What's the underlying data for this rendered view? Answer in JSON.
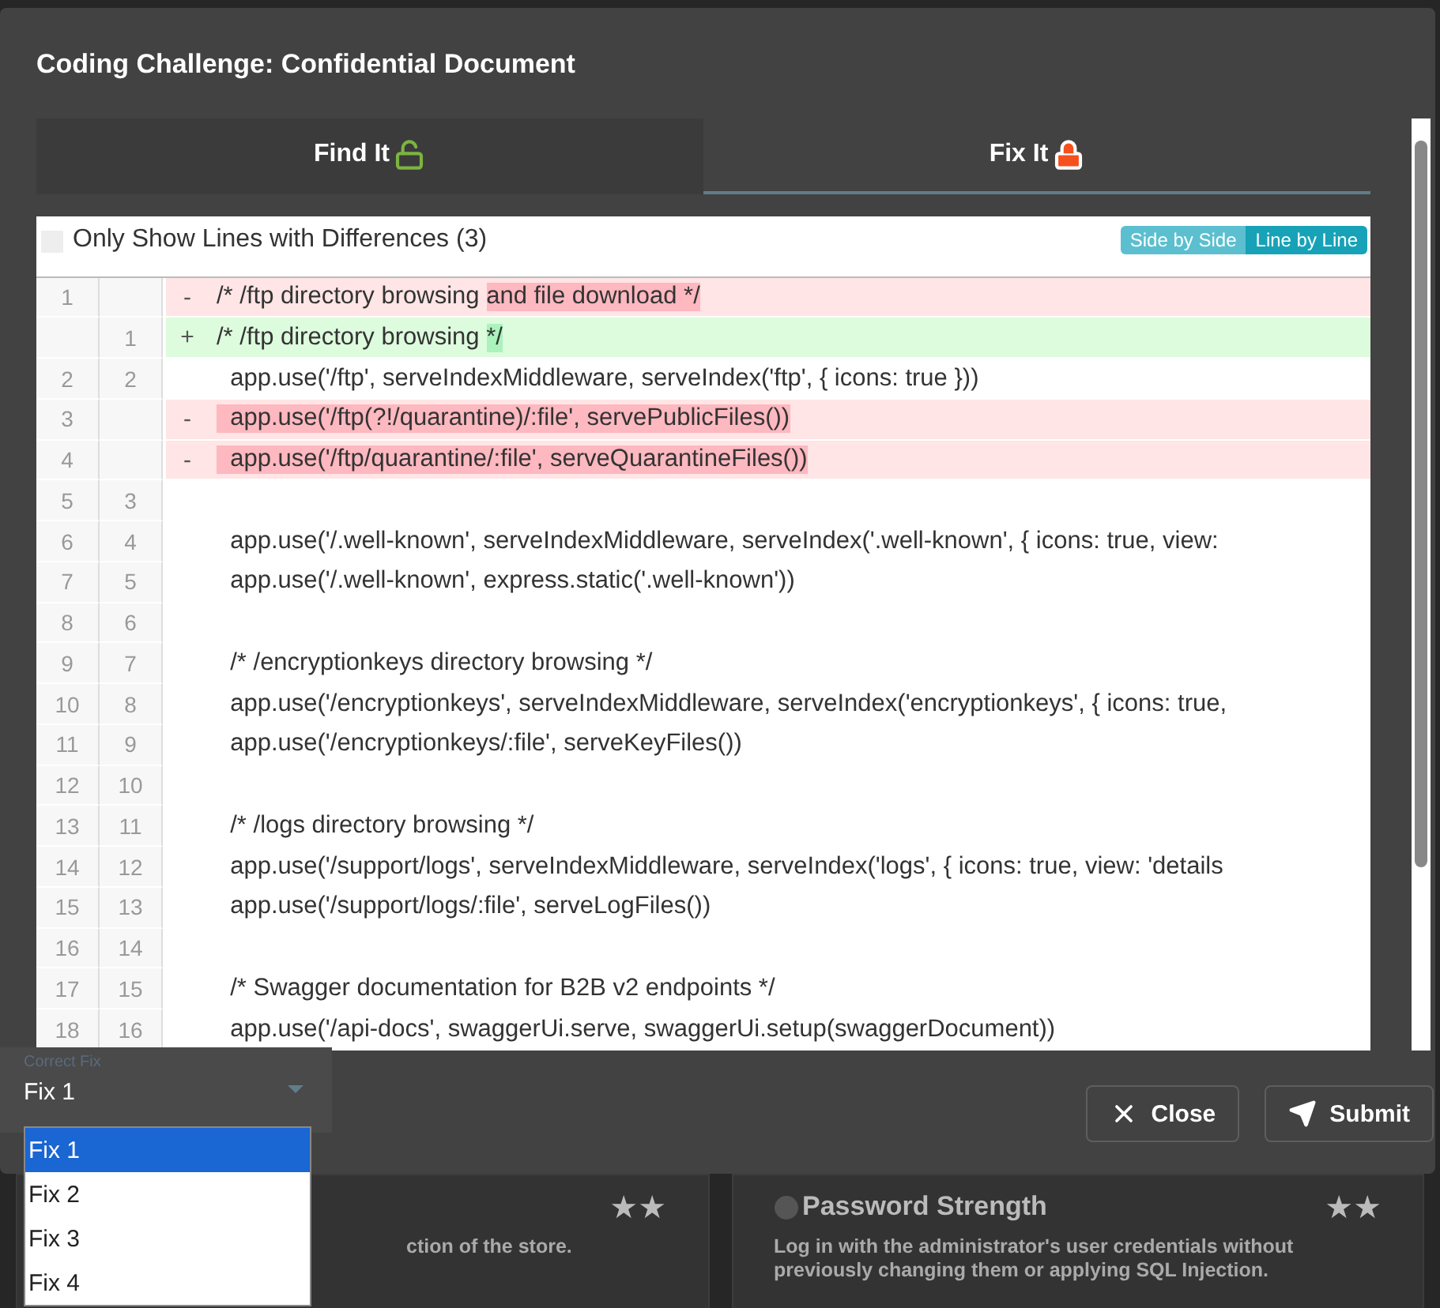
{
  "dialog": {
    "title": "Coding Challenge: Confidential Document",
    "tabs": [
      {
        "label": "Find It",
        "selected": false,
        "locked": false
      },
      {
        "label": "Fix It",
        "selected": true,
        "locked": true
      }
    ],
    "diff": {
      "filter": {
        "label": "Only Show Lines with Differences (3)",
        "checked": false
      },
      "views": [
        {
          "label": "Side by Side",
          "selected": false
        },
        {
          "label": "Line by Line",
          "selected": true
        }
      ],
      "lines": [
        {
          "old": "1",
          "kind": "del",
          "sign": "-",
          "parts": [
            {
              "text": "/* /ftp directory browsing ",
              "hl": false
            },
            {
              "text": "and file download */",
              "hl": true
            }
          ]
        },
        {
          "new": "1",
          "kind": "ins",
          "sign": "+",
          "parts": [
            {
              "text": "/* /ftp directory browsing ",
              "hl": false
            },
            {
              "text": "*/",
              "hl": true
            }
          ]
        },
        {
          "old": "2",
          "new": "2",
          "kind": "ctx",
          "parts": [
            {
              "text": "  app.use('/ftp', serveIndexMiddleware, serveIndex('ftp', { icons: true }))",
              "hl": false
            }
          ]
        },
        {
          "old": "3",
          "kind": "del",
          "sign": "-",
          "parts": [
            {
              "text": "  app.use('/ftp(?!/quarantine)/:file', servePublicFiles())",
              "hl": true
            }
          ]
        },
        {
          "old": "4",
          "kind": "del",
          "sign": "-",
          "parts": [
            {
              "text": "  app.use('/ftp/quarantine/:file', serveQuarantineFiles())",
              "hl": true
            }
          ]
        },
        {
          "old": "5",
          "new": "3",
          "kind": "ctx"
        },
        {
          "old": "6",
          "new": "4",
          "kind": "ctx",
          "parts": [
            {
              "text": "  app.use('/.well-known', serveIndexMiddleware, serveIndex('.well-known', { icons: true, view:",
              "hl": false
            }
          ]
        },
        {
          "old": "7",
          "new": "5",
          "kind": "ctx",
          "parts": [
            {
              "text": "  app.use('/.well-known', express.static('.well-known'))",
              "hl": false
            }
          ]
        },
        {
          "old": "8",
          "new": "6",
          "kind": "ctx"
        },
        {
          "old": "9",
          "new": "7",
          "kind": "ctx",
          "parts": [
            {
              "text": "  /* /encryptionkeys directory browsing */",
              "hl": false
            }
          ]
        },
        {
          "old": "10",
          "new": "8",
          "kind": "ctx",
          "parts": [
            {
              "text": "  app.use('/encryptionkeys', serveIndexMiddleware, serveIndex('encryptionkeys', { icons: true,",
              "hl": false
            }
          ]
        },
        {
          "old": "11",
          "new": "9",
          "kind": "ctx",
          "parts": [
            {
              "text": "  app.use('/encryptionkeys/:file', serveKeyFiles())",
              "hl": false
            }
          ]
        },
        {
          "old": "12",
          "new": "10",
          "kind": "ctx"
        },
        {
          "old": "13",
          "new": "11",
          "kind": "ctx",
          "parts": [
            {
              "text": "  /* /logs directory browsing */",
              "hl": false
            }
          ]
        },
        {
          "old": "14",
          "new": "12",
          "kind": "ctx",
          "parts": [
            {
              "text": "  app.use('/support/logs', serveIndexMiddleware, serveIndex('logs', { icons: true, view: 'details",
              "hl": false
            }
          ]
        },
        {
          "old": "15",
          "new": "13",
          "kind": "ctx",
          "parts": [
            {
              "text": "  app.use('/support/logs/:file', serveLogFiles())",
              "hl": false
            }
          ]
        },
        {
          "old": "16",
          "new": "14",
          "kind": "ctx"
        },
        {
          "old": "17",
          "new": "15",
          "kind": "ctx",
          "parts": [
            {
              "text": "  /* Swagger documentation for B2B v2 endpoints */",
              "hl": false
            }
          ]
        },
        {
          "old": "18",
          "new": "16",
          "kind": "ctx",
          "parts": [
            {
              "text": "  app.use('/api-docs', swaggerUi.serve, swaggerUi.setup(swaggerDocument))",
              "hl": false
            }
          ]
        }
      ]
    },
    "select": {
      "label": "Correct Fix",
      "value": "Fix 1",
      "options": [
        {
          "label": "Fix 1",
          "selected": true
        },
        {
          "label": "Fix 2",
          "selected": false
        },
        {
          "label": "Fix 3",
          "selected": false
        },
        {
          "label": "Fix 4",
          "selected": false
        }
      ]
    },
    "buttons": [
      {
        "label": "Close",
        "kind": "close"
      },
      {
        "label": "Submit",
        "kind": "submit"
      }
    ]
  },
  "cards": [
    {
      "difficulty": "★★",
      "description": "ction of the store."
    },
    {
      "title": "Password Strength",
      "difficulty": "★★",
      "description": "Log in with the administrator's user credentials without previously changing them or applying SQL Injection."
    }
  ]
}
